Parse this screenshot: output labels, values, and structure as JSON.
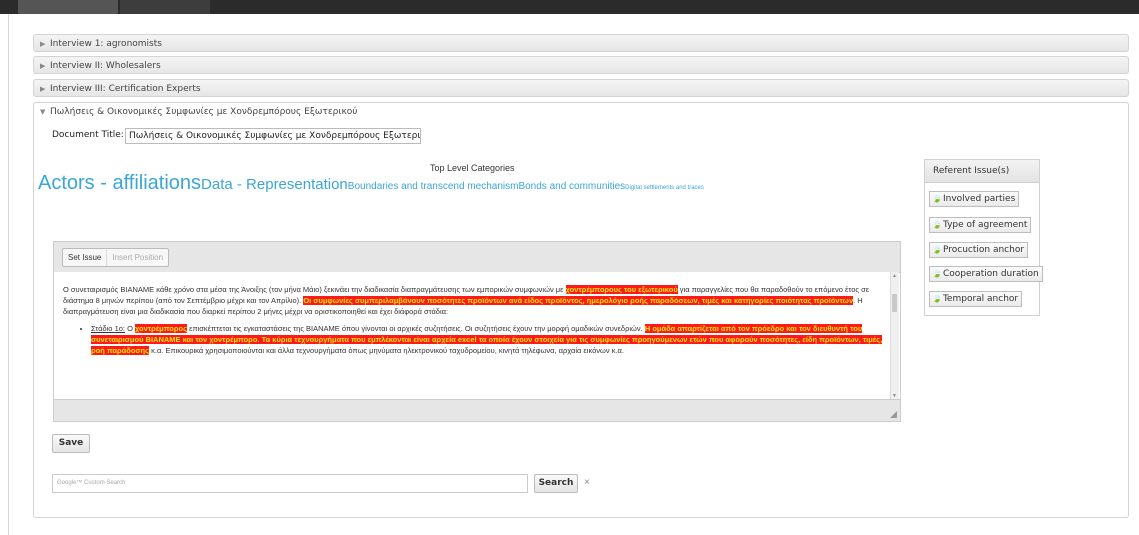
{
  "accordion": {
    "items": [
      {
        "label": "Interview 1: agronomists"
      },
      {
        "label": "Interview II: Wholesalers"
      },
      {
        "label": "Interview III: Certification Experts"
      },
      {
        "label": "Πωλήσεις & Οικονομικές Συμφωνίες με Χονδρεμπόρους Εξωτερικού"
      }
    ]
  },
  "document": {
    "title_label": "Document Title:",
    "title_value": "Πωλήσεις & Οικονομικές Συμφωνίες με Χονδρεμπόρους Εξωτερι"
  },
  "categories": {
    "heading": "Top Level Categories",
    "items": [
      "Actors - affiliations",
      "Data - Representation",
      "Boundaries and transcend mechanism",
      "Bonds and communities",
      "Digital settlements and traces"
    ],
    "color": "#3aa6d6"
  },
  "issues": {
    "heading": "Referent Issue(s)",
    "items": [
      "Involved parties",
      "Type of agreement",
      "Procuction anchor",
      "Cooperation duration",
      "Temporal anchor"
    ]
  },
  "editor": {
    "set_issue": "Set Issue",
    "insert_position": "Insert Position",
    "p1_a": "Ο συνεταιρισμός ΒΙΑΝΑΜΕ κάθε χρόνο στα μέσα της Άνοιξης (τον μήνα Μάιο) ξεκινάει την διαδικασία διαπραγμάτευσης των εμπορικών συμφωνιών με ",
    "p1_hl1": "χοντρέμπορους του εξωτερικού",
    "p1_b": " για παραγγελίες που θα παραδοθούν το επόμενο έτος σε διάστημα 8 μηνών περίπου (από τον Σεπτέμβριο μέχρι και τον Απρίλιο). ",
    "p1_hl2": "Οι συμφωνίες συμπεριλαμβάνουν ποσότητες προϊόντων ανά είδος προϊόντος, ημερολόγιο ροής παραδόσεων, τιμές και κατηγορίες ποιότητας προϊόντων",
    "p1_c": ". Η διαπραγμάτευση είναι μια διαδικασία που διαρκεί περίπου 2 μήνες μέχρι να οριστικοποιηθεί και έχει διάφορά στάδια:",
    "li_stage": "Στάδιο 1ο:",
    "li_a": " Ο ",
    "li_hl1": "χοντρέμπορος",
    "li_b": " επισκέπτεται τις εγκαταστάσεις της ΒΙΑΝΑΜΕ όπου γίνονται οι αρχικές συζητήσεις. Οι συζητήσεις έχουν την μορφή ομαδικών συνεδριών. ",
    "li_hl2": "Η ομάδα απαρτίζεται από τον πρόεδρο και τον διευθυντή του συνεταιρισμού ΒΙΑΝΑΜΕ και τον χοντρέμπορο. Τα κύρια τεχνουργήματα που εμπλέκονται είναι αρχεία excel τα οποία έχουν στοιχεία για τις συμφωνίες προηγούμενων ετών που αφορούν ποσότητες, είδη προϊόντων, τιμές, ροή παράδοσης",
    "li_c": " κ.α. Επικουρικά χρησιμοποιούνται και άλλα τεχνουργήματα όπως μηνύματα ηλεκτρονικού ταχυδρομείου, κινητά τηλέφωνα, αρχαία εικόνων κ.α.",
    "highlight_bg": "#ff1a1a",
    "highlight_fg": "#ffe900"
  },
  "actions": {
    "save": "Save",
    "search_placeholder": "Google™ Custom Search",
    "search": "Search",
    "clear": "×"
  }
}
